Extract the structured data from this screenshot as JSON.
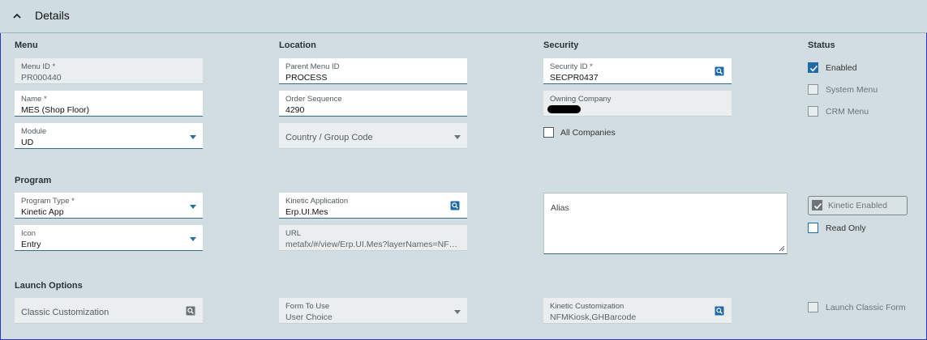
{
  "header": {
    "title": "Details"
  },
  "sections": {
    "menu": "Menu",
    "location": "Location",
    "security": "Security",
    "status": "Status",
    "program": "Program",
    "launch": "Launch Options"
  },
  "menu": {
    "menu_id_label": "Menu ID *",
    "menu_id_value": "PR000440",
    "name_label": "Name *",
    "name_value": "MES (Shop Floor)",
    "module_label": "Module",
    "module_value": "UD"
  },
  "location": {
    "parent_label": "Parent Menu ID",
    "parent_value": "PROCESS",
    "order_label": "Order Sequence",
    "order_value": "4290",
    "country_placeholder": "Country / Group Code"
  },
  "security": {
    "security_id_label": "Security ID *",
    "security_id_value": "SECPR0437",
    "owning_label": "Owning Company",
    "all_companies_label": "All Companies"
  },
  "status": {
    "enabled_label": "Enabled",
    "system_menu_label": "System Menu",
    "crm_menu_label": "CRM Menu"
  },
  "program": {
    "type_label": "Program Type *",
    "type_value": "Kinetic App",
    "icon_label": "Icon",
    "icon_value": "Entry",
    "kinetic_app_label": "Kinetic Application",
    "kinetic_app_value": "Erp.UI.Mes",
    "url_label": "URL",
    "url_value": "metafx/#/view/Erp.UI.Mes?layerNames=NFMKiosk,GHBarcode",
    "alias_placeholder": "Alias",
    "kinetic_enabled_label": "Kinetic Enabled",
    "read_only_label": "Read Only"
  },
  "launch": {
    "classic_placeholder": "Classic Customization",
    "form_label": "Form To Use",
    "form_value": "User Choice",
    "kinetic_cust_label": "Kinetic Customization",
    "kinetic_cust_value": "NFMKiosk,GHBarcode",
    "launch_classic_label": "Launch Classic Form"
  },
  "icons": {
    "collapse": "chevron-up-icon",
    "dropdown": "caret-down-icon",
    "search": "search-icon",
    "check": "checkmark-icon"
  },
  "colors": {
    "background": "#d1dde1",
    "accent": "#1f6aa8",
    "field_underline": "#3a6a8c"
  }
}
